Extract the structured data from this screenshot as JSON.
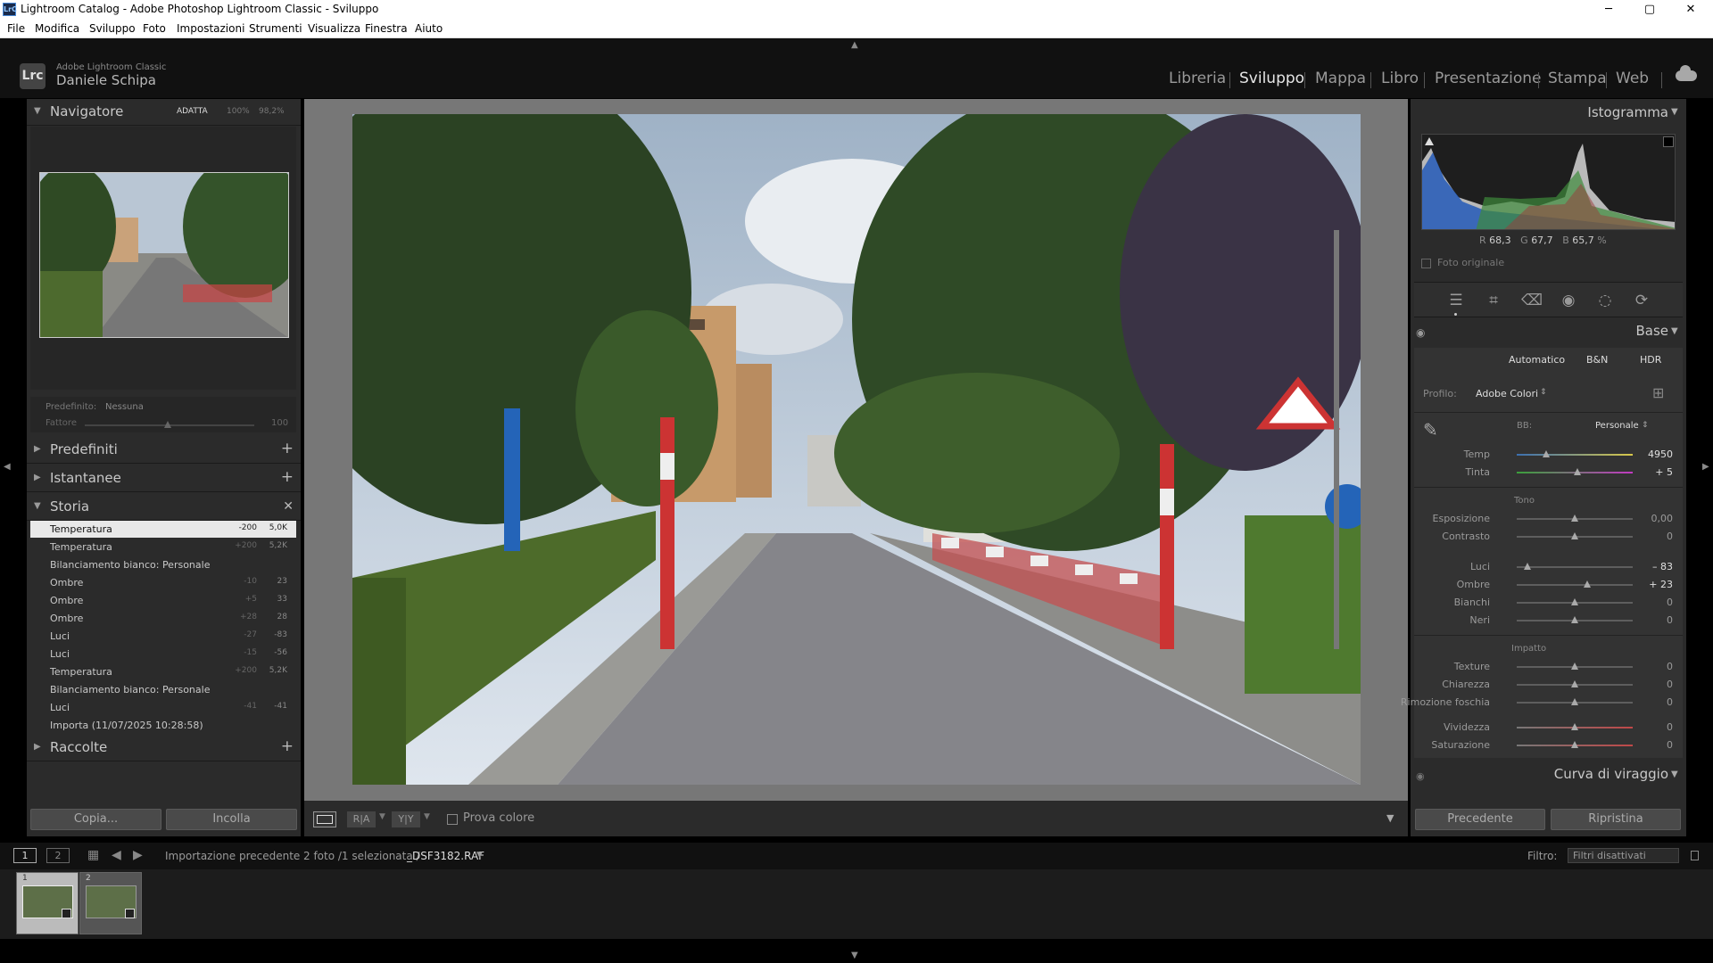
{
  "window": {
    "title": "Lightroom Catalog - Adobe Photoshop Lightroom Classic - Sviluppo",
    "app_icon": "LrC",
    "minimize": "─",
    "maximize": "▢",
    "close": "✕"
  },
  "menu": [
    "File",
    "Modifica",
    "Sviluppo",
    "Foto",
    "Impostazioni",
    "Strumenti",
    "Visualizza",
    "Finestra",
    "Aiuto"
  ],
  "identity": {
    "app_name": "Adobe Lightroom Classic",
    "user": "Daniele Schipa",
    "logo": "Lrc"
  },
  "modules": [
    "Libreria",
    "Sviluppo",
    "Mappa",
    "Libro",
    "Presentazione",
    "Stampa",
    "Web"
  ],
  "active_module": "Sviluppo",
  "navigator": {
    "title": "Navigatore",
    "fit": "ADATTA",
    "zoom1": "100%",
    "zoom2": "98,2%"
  },
  "preset_amount": {
    "preset_label": "Predefinito:",
    "preset_value": "Nessuna",
    "factor_label": "Fattore",
    "factor_value": "100"
  },
  "panels_left": {
    "presets": "Predefiniti",
    "snapshots": "Istantanee",
    "history": "Storia",
    "collections": "Raccolte"
  },
  "history": [
    {
      "name": "Temperatura",
      "delta": "-200",
      "value": "5,0K",
      "selected": true
    },
    {
      "name": "Temperatura",
      "delta": "+200",
      "value": "5,2K"
    },
    {
      "name": "Bilanciamento bianco: Personale",
      "delta": "",
      "value": ""
    },
    {
      "name": "Ombre",
      "delta": "-10",
      "value": "23"
    },
    {
      "name": "Ombre",
      "delta": "+5",
      "value": "33"
    },
    {
      "name": "Ombre",
      "delta": "+28",
      "value": "28"
    },
    {
      "name": "Luci",
      "delta": "-27",
      "value": "-83"
    },
    {
      "name": "Luci",
      "delta": "-15",
      "value": "-56"
    },
    {
      "name": "Temperatura",
      "delta": "+200",
      "value": "5,2K"
    },
    {
      "name": "Bilanciamento bianco: Personale",
      "delta": "",
      "value": ""
    },
    {
      "name": "Luci",
      "delta": "-41",
      "value": "-41"
    },
    {
      "name": "Importa (11/07/2025 10:28:58)",
      "delta": "",
      "value": ""
    }
  ],
  "left_buttons": {
    "copy": "Copia...",
    "paste": "Incolla"
  },
  "toolbar": {
    "soft_proof": "Prova colore",
    "view_ba1": "R|A",
    "view_ba2": "Y|Y"
  },
  "histogram": {
    "title": "Istogramma",
    "r_label": "R",
    "r": "68,3",
    "g_label": "G",
    "g": "67,7",
    "b_label": "B",
    "b": "65,7",
    "pct": "%",
    "original": "Foto originale"
  },
  "basic": {
    "title": "Base",
    "treatment": [
      "Automatico",
      "B&N",
      "HDR"
    ],
    "profile_label": "Profilo:",
    "profile_value": "Adobe Colori",
    "wb_label": "BB:",
    "wb_value": "Personale",
    "tone_label": "Tono",
    "presence_label": "Impatto",
    "wb_sliders": [
      {
        "name": "Temp",
        "value": "4950",
        "pos": 0.25
      },
      {
        "name": "Tinta",
        "value": "+ 5",
        "pos": 0.52
      }
    ],
    "tone_sliders": [
      {
        "name": "Esposizione",
        "value": "0,00",
        "pos": 0.5
      },
      {
        "name": "Contrasto",
        "value": "0",
        "pos": 0.5
      },
      {
        "name": "Luci",
        "value": "– 83",
        "pos": 0.09
      },
      {
        "name": "Ombre",
        "value": "+ 23",
        "pos": 0.61
      },
      {
        "name": "Bianchi",
        "value": "0",
        "pos": 0.5
      },
      {
        "name": "Neri",
        "value": "0",
        "pos": 0.5
      }
    ],
    "presence_sliders": [
      {
        "name": "Texture",
        "value": "0",
        "pos": 0.5
      },
      {
        "name": "Chiarezza",
        "value": "0",
        "pos": 0.5
      },
      {
        "name": "Rimozione foschia",
        "value": "0",
        "pos": 0.5
      },
      {
        "name": "Vividezza",
        "value": "0",
        "pos": 0.5
      },
      {
        "name": "Saturazione",
        "value": "0",
        "pos": 0.5
      }
    ]
  },
  "tone_curve": {
    "title": "Curva di viraggio"
  },
  "right_buttons": {
    "previous": "Precedente",
    "reset": "Ripristina"
  },
  "filmstrip_bar": {
    "view1": "1",
    "view2": "2",
    "source": "Importazione precedente",
    "count": "2 foto /1 selezionata /",
    "file": "_DSF3182.RAF",
    "filter_label": "Filtro:",
    "filter_value": "Filtri disattivati"
  },
  "thumbnails": [
    {
      "index": "1",
      "selected": true
    },
    {
      "index": "2",
      "selected": false
    }
  ],
  "colors": {
    "accent": "#e6e6e6",
    "panel": "#2b2b2b",
    "background": "#000000",
    "center": "#777777"
  }
}
